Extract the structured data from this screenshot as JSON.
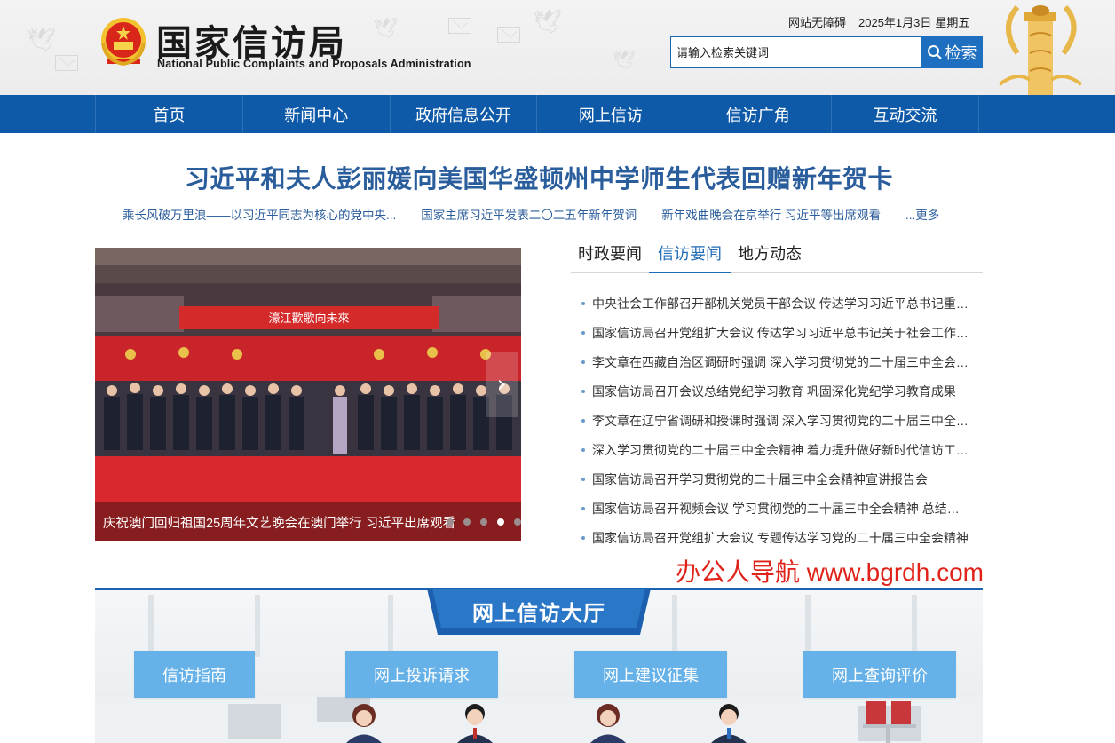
{
  "header": {
    "site_title_cn": "国家信访局",
    "site_title_en": "National Public Complaints and Proposals Administration",
    "accessibility_link": "网站无障碍",
    "date": "2025年1月3日",
    "weekday": "星期五",
    "search": {
      "placeholder": "请输入检索关键词",
      "button_label": "检索"
    }
  },
  "nav": {
    "items": [
      {
        "label": "首页"
      },
      {
        "label": "新闻中心"
      },
      {
        "label": "政府信息公开"
      },
      {
        "label": "网上信访"
      },
      {
        "label": "信访广角"
      },
      {
        "label": "互动交流"
      }
    ]
  },
  "headline": {
    "title": "习近平和夫人彭丽媛向美国华盛顿州中学师生代表回赠新年贺卡",
    "sub_links": [
      {
        "label": "乘长风破万里浪——以习近平同志为核心的党中央..."
      },
      {
        "label": "国家主席习近平发表二〇二五年新年贺词"
      },
      {
        "label": "新年戏曲晚会在京举行 习近平等出席观看"
      },
      {
        "label": "...更多"
      }
    ]
  },
  "slideshow": {
    "caption": "庆祝澳门回归祖国25周年文艺晚会在澳门举行 习近平出席观看",
    "banner_text": "濠江歡歌向未來",
    "slide_count": 5,
    "active_index": 3
  },
  "news_tabs": {
    "tabs": [
      {
        "label": "时政要闻",
        "active": false
      },
      {
        "label": "信访要闻",
        "active": true
      },
      {
        "label": "地方动态",
        "active": false
      }
    ],
    "items": [
      "中央社会工作部召开部机关党员干部会议 传达学习习近平总书记重要讲话精神",
      "国家信访局召开党组扩大会议 传达学习习近平总书记关于社会工作的重要指示",
      "李文章在西藏自治区调研时强调 深入学习贯彻党的二十届三中全会精神",
      "国家信访局召开会议总结党纪学习教育 巩固深化党纪学习教育成果",
      "李文章在辽宁省调研和授课时强调 深入学习贯彻党的二十届三中全会精神",
      "深入学习贯彻党的二十届三中全会精神 着力提升做好新时代信访工作能力",
      "国家信访局召开学习贯彻党的二十届三中全会精神宣讲报告会",
      "国家信访局召开视频会议 学习贯彻党的二十届三中全会精神 总结部署工作",
      "国家信访局召开党组扩大会议 专题传达学习党的二十届三中全会精神"
    ]
  },
  "watermark": "办公人导航 www.bgrdh.com",
  "hall": {
    "title": "网上信访大厅",
    "buttons": [
      {
        "label": "信访指南"
      },
      {
        "label": "网上投诉请求"
      },
      {
        "label": "网上建议征集"
      },
      {
        "label": "网上查询评价"
      }
    ]
  },
  "colors": {
    "nav_blue": "#0f5aa8",
    "headline_blue": "#2a5d9c",
    "button_light_blue": "#66b1e8",
    "watermark_red": "#e0231a"
  }
}
